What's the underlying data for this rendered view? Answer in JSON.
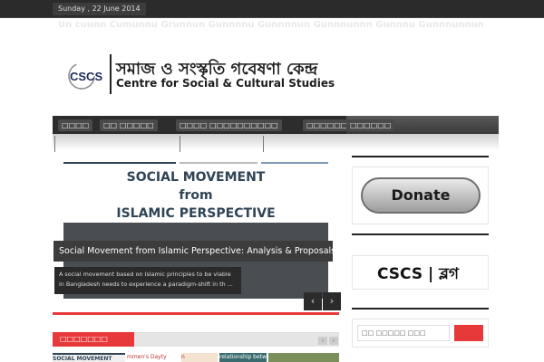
{
  "topbar": {
    "date": "Sunday , 22 June 2014"
  },
  "ghost_links": "Un cuunn Cumunnu   Grunnun Gunnnnu   Gunnnnun   Gunnnunnn Gunnnu   Gunnnunnun",
  "logo": {
    "mark_text": "CSCS",
    "name_bn": "সমাজ ও সংস্কৃতি গবেষণা কেন্দ্র",
    "name_en": "Centre for Social & Cultural Studies",
    "accent": "#1b2c5c"
  },
  "nav": {
    "items": [
      "□□□□",
      "□□ □□□□□",
      "□□□□ □□□□□□□□□□",
      "□□□□□□ □□□□□",
      "□□□□□□"
    ]
  },
  "slider": {
    "slide_title": [
      "SOCIAL MOVEMENT",
      "from",
      "ISLAMIC PERSPECTIVE"
    ],
    "caption_title": "Social Movement from Islamic Perspective: Analysis & Proposals",
    "caption_text": "A social movement based on Islamic principles to be viable in Bangladesh needs to experience a paradigm-shift in th ...",
    "prev_icon": "‹",
    "next_icon": "›"
  },
  "section": {
    "label": "□□□□□□□",
    "prev_icon": "‹",
    "next_icon": "›"
  },
  "thumbs": [
    "SOCIAL MOVEMENT",
    "mmen's Dayty",
    "n",
    "relationship between",
    ""
  ],
  "sidebar": {
    "donate_label": "Donate",
    "blog_logo": "CSCS | ব্লগ",
    "search_placeholder": "□□ □□□□□ □□□",
    "accent_red": "#e8393a"
  }
}
